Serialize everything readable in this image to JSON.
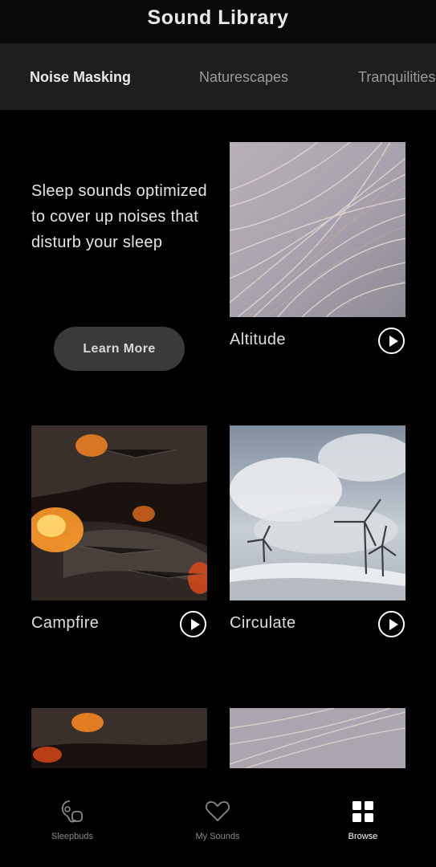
{
  "header": {
    "title": "Sound Library"
  },
  "tabs": [
    {
      "label": "Noise Masking",
      "active": true
    },
    {
      "label": "Naturescapes",
      "active": false
    },
    {
      "label": "Tranquilities",
      "active": false
    }
  ],
  "intro": {
    "text": "Sleep sounds optimized to cover up noises that disturb your sleep",
    "learn_more_label": "Learn More"
  },
  "sounds": [
    {
      "title": "Altitude",
      "image": "dry-grass"
    },
    {
      "title": "Campfire",
      "image": "burning-logs"
    },
    {
      "title": "Circulate",
      "image": "wind-turbines"
    }
  ],
  "bottom_nav": [
    {
      "label": "Sleepbuds",
      "icon": "sleepbuds-icon",
      "active": false
    },
    {
      "label": "My Sounds",
      "icon": "heart-icon",
      "active": false
    },
    {
      "label": "Browse",
      "icon": "grid-icon",
      "active": true
    }
  ],
  "colors": {
    "background": "#000000",
    "tab_bar": "#1e1e1e",
    "button": "#3a3a3a"
  }
}
